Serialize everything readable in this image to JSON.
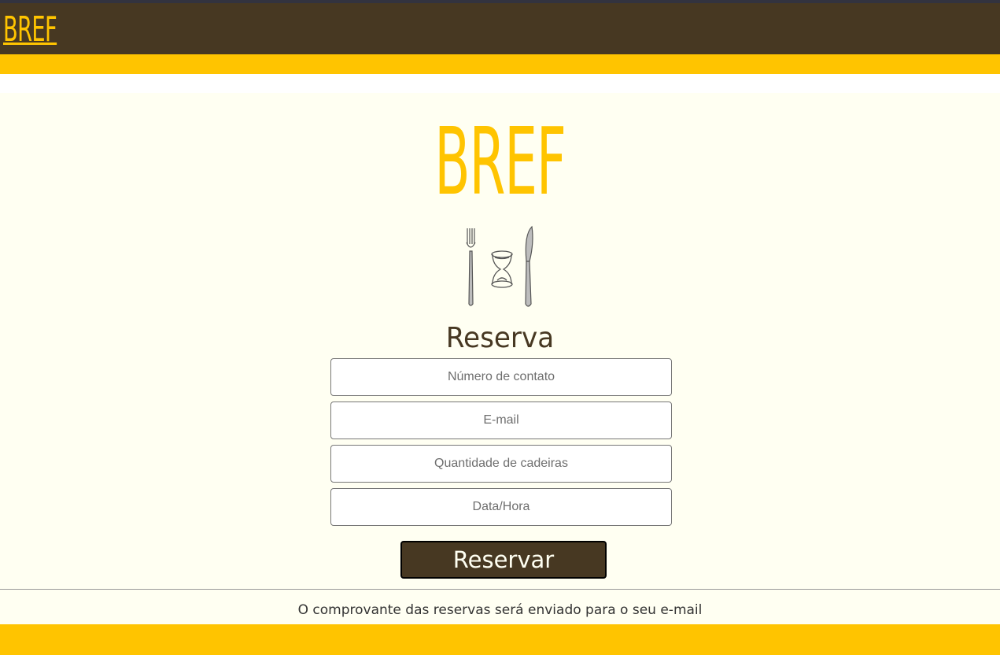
{
  "header": {
    "logo_text": "BREF"
  },
  "hero": {
    "title": "BREF",
    "logo_icon": "fork-hourglass-knife-icon"
  },
  "form": {
    "title": "Reserva",
    "fields": [
      {
        "placeholder": "Número de contato",
        "value": ""
      },
      {
        "placeholder": "E-mail",
        "value": ""
      },
      {
        "placeholder": "Quantidade de cadeiras",
        "value": ""
      },
      {
        "placeholder": "Data/Hora",
        "value": ""
      }
    ],
    "submit_label": "Reservar"
  },
  "note": "O comprovante das reservas será enviado para o seu e-mail",
  "colors": {
    "header_bg": "#473822",
    "accent_yellow": "#ffc400",
    "page_bg": "#fffff2"
  }
}
